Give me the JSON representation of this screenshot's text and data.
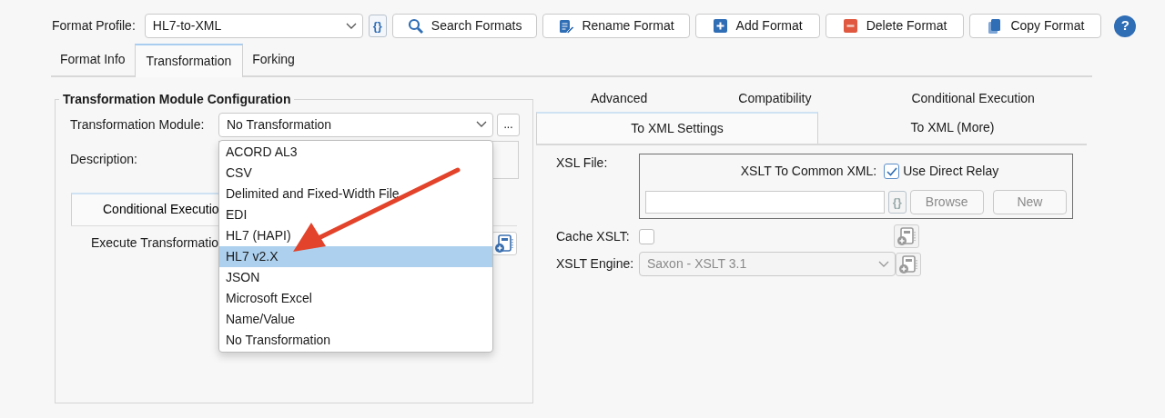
{
  "toolbar": {
    "profile_label": "Format Profile:",
    "profile_value": "HL7-to-XML",
    "expression_button": "{}",
    "buttons": [
      {
        "label": "Search Formats",
        "kind": "search"
      },
      {
        "label": "Rename Format",
        "kind": "rename"
      },
      {
        "label": "Add Format",
        "kind": "add"
      },
      {
        "label": "Delete Format",
        "kind": "delete"
      },
      {
        "label": "Copy Format",
        "kind": "copy"
      }
    ],
    "help_button": "?"
  },
  "tabs": [
    {
      "label": "Format Info",
      "selected": false
    },
    {
      "label": "Transformation",
      "selected": true
    },
    {
      "label": "Forking",
      "selected": false
    }
  ],
  "module_config": {
    "title": "Transformation Module Configuration",
    "module_label": "Transformation Module:",
    "module_value": "No Transformation",
    "more_button": "...",
    "description_label": "Description:",
    "inner_tabs": [
      {
        "label": "Conditional Executio",
        "selected": true
      }
    ],
    "execute_label": "Execute Transformatio",
    "dropdown": [
      {
        "label": "ACORD AL3",
        "selected": false
      },
      {
        "label": "CSV",
        "selected": false
      },
      {
        "label": "Delimited and Fixed-Width File",
        "selected": false
      },
      {
        "label": "EDI",
        "selected": false
      },
      {
        "label": "HL7 (HAPI)",
        "selected": false
      },
      {
        "label": "HL7 v2.X",
        "selected": true
      },
      {
        "label": "JSON",
        "selected": false
      },
      {
        "label": "Microsoft Excel",
        "selected": false
      },
      {
        "label": "Name/Value",
        "selected": false
      },
      {
        "label": "No Transformation",
        "selected": false
      }
    ]
  },
  "settings": {
    "upper_tabs": [
      {
        "label": "Advanced",
        "selected": false
      },
      {
        "label": "Compatibility",
        "selected": false
      },
      {
        "label": "Conditional Execution",
        "selected": false
      }
    ],
    "lower_tabs": [
      {
        "label": "To XML Settings",
        "selected": true
      },
      {
        "label": "To XML (More)",
        "selected": false
      }
    ],
    "xsl_file_label": "XSL File:",
    "xslt_common_label": "XSLT To Common XML:",
    "direct_relay": {
      "label": "Use Direct Relay",
      "checked": true
    },
    "expression_button": "{}",
    "browse_button": "Browse",
    "new_button": "New",
    "file_buttons_disabled": true,
    "cache_label": "Cache XSLT:",
    "cache_checked": false,
    "engine_label": "XSLT Engine:",
    "engine_value": "Saxon - XSLT 3.1",
    "engine_disabled": true
  }
}
